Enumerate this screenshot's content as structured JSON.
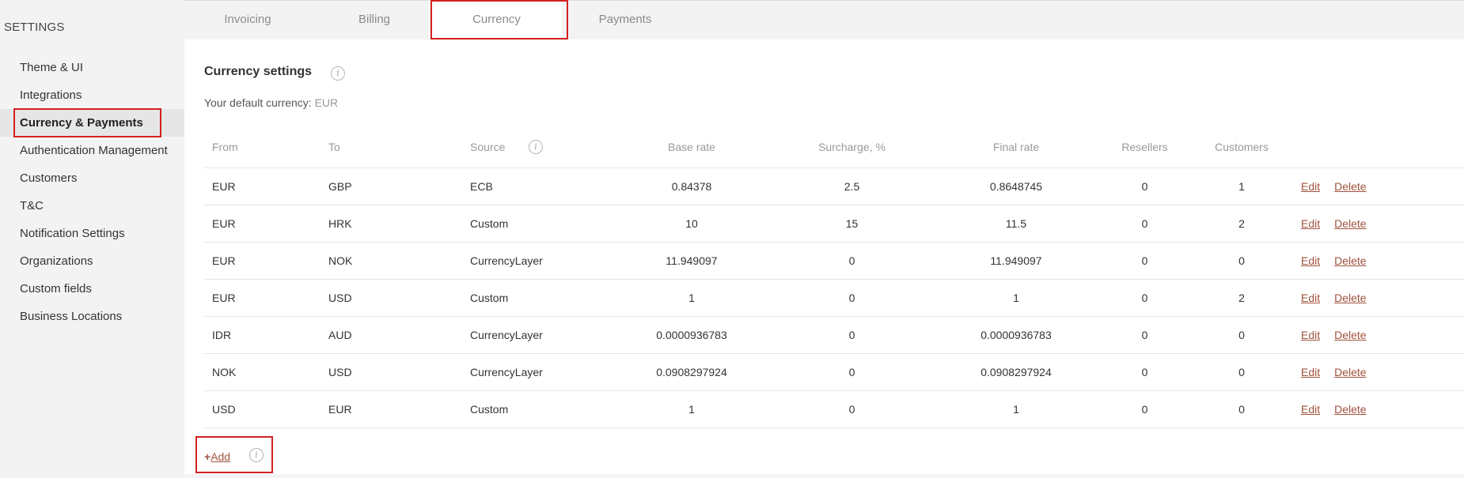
{
  "sidebar": {
    "heading": "SETTINGS",
    "items": [
      {
        "label": "Theme & UI"
      },
      {
        "label": "Integrations"
      },
      {
        "label": "Currency & Payments"
      },
      {
        "label": "Authentication Management"
      },
      {
        "label": "Customers"
      },
      {
        "label": "T&C"
      },
      {
        "label": "Notification Settings"
      },
      {
        "label": "Organizations"
      },
      {
        "label": "Custom fields"
      },
      {
        "label": "Business Locations"
      }
    ],
    "active_index": 2
  },
  "tabs": [
    {
      "label": "Invoicing"
    },
    {
      "label": "Billing"
    },
    {
      "label": "Currency"
    },
    {
      "label": "Payments"
    }
  ],
  "main": {
    "title": "Currency settings",
    "default_currency_label": "Your default currency:",
    "default_currency_value": "EUR",
    "columns": {
      "from": "From",
      "to": "To",
      "source": "Source",
      "base_rate": "Base rate",
      "surcharge": "Surcharge, %",
      "final_rate": "Final rate",
      "resellers": "Resellers",
      "customers": "Customers"
    },
    "rows": [
      {
        "from": "EUR",
        "to": "GBP",
        "source": "ECB",
        "base_rate": "0.84378",
        "surcharge": "2.5",
        "final_rate": "0.8648745",
        "resellers": "0",
        "customers": "1"
      },
      {
        "from": "EUR",
        "to": "HRK",
        "source": "Custom",
        "base_rate": "10",
        "surcharge": "15",
        "final_rate": "11.5",
        "resellers": "0",
        "customers": "2"
      },
      {
        "from": "EUR",
        "to": "NOK",
        "source": "CurrencyLayer",
        "base_rate": "11.949097",
        "surcharge": "0",
        "final_rate": "11.949097",
        "resellers": "0",
        "customers": "0"
      },
      {
        "from": "EUR",
        "to": "USD",
        "source": "Custom",
        "base_rate": "1",
        "surcharge": "0",
        "final_rate": "1",
        "resellers": "0",
        "customers": "2"
      },
      {
        "from": "IDR",
        "to": "AUD",
        "source": "CurrencyLayer",
        "base_rate": "0.0000936783",
        "surcharge": "0",
        "final_rate": "0.0000936783",
        "resellers": "0",
        "customers": "0"
      },
      {
        "from": "NOK",
        "to": "USD",
        "source": "CurrencyLayer",
        "base_rate": "0.0908297924",
        "surcharge": "0",
        "final_rate": "0.0908297924",
        "resellers": "0",
        "customers": "0"
      },
      {
        "from": "USD",
        "to": "EUR",
        "source": "Custom",
        "base_rate": "1",
        "surcharge": "0",
        "final_rate": "1",
        "resellers": "0",
        "customers": "0"
      }
    ],
    "edit_label": "Edit",
    "delete_label": "Delete",
    "add_label": "Add"
  },
  "colors": {
    "link": "#a0523d",
    "highlight": "#d42020"
  }
}
